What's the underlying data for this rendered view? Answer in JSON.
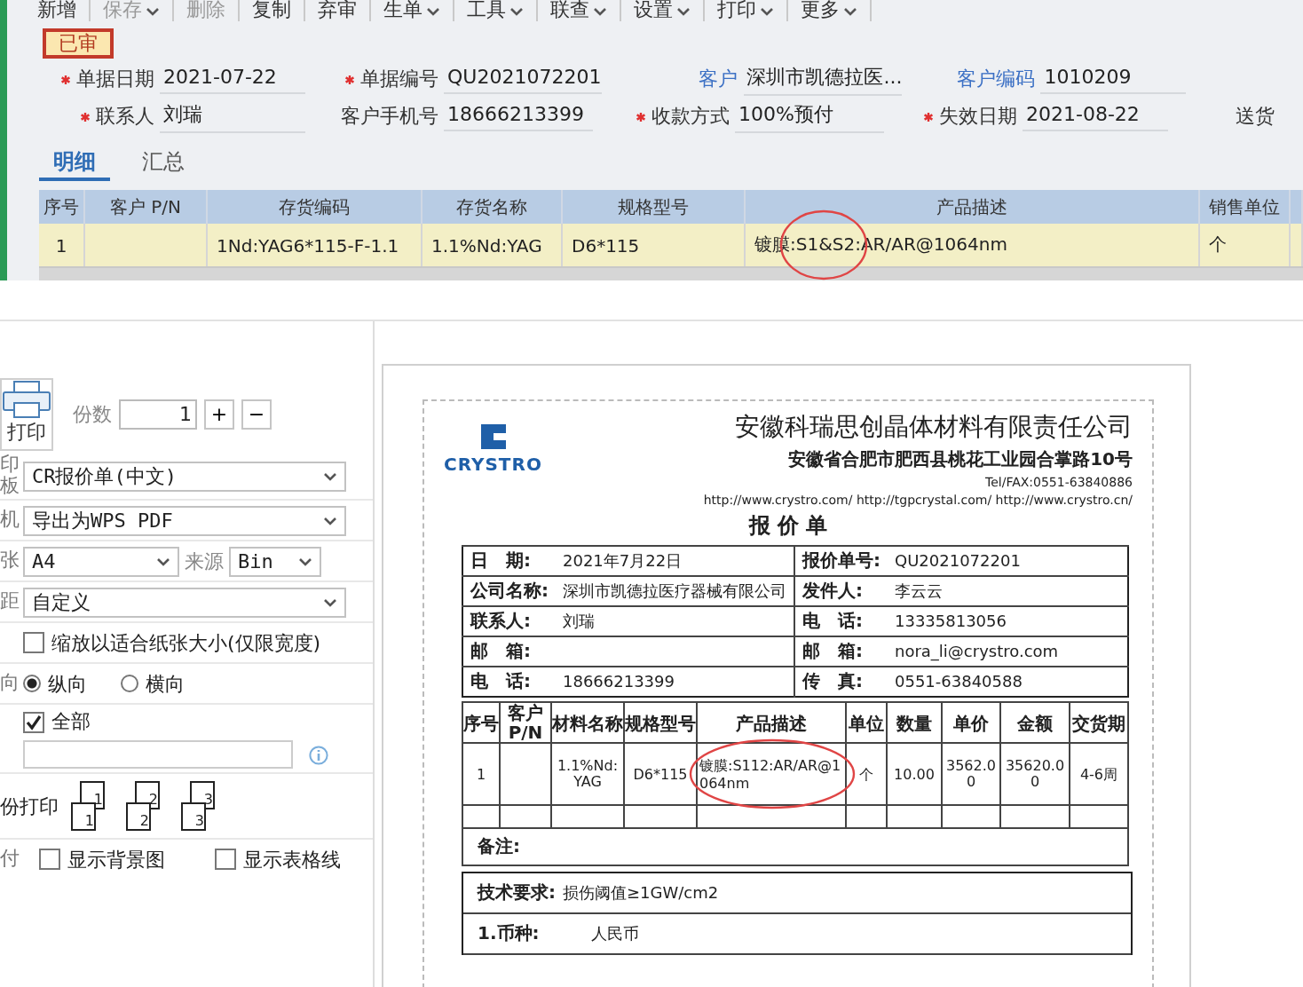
{
  "toolbar": [
    {
      "label": "新增",
      "disabled": false,
      "menu": false
    },
    {
      "label": "保存",
      "disabled": true,
      "menu": true
    },
    {
      "label": "删除",
      "disabled": true,
      "menu": false
    },
    {
      "label": "复制",
      "disabled": false,
      "menu": false
    },
    {
      "label": "弃审",
      "disabled": false,
      "menu": false
    },
    {
      "label": "生单",
      "disabled": false,
      "menu": true
    },
    {
      "label": "工具",
      "disabled": false,
      "menu": true
    },
    {
      "label": "联查",
      "disabled": false,
      "menu": true
    },
    {
      "label": "设置",
      "disabled": false,
      "menu": true
    },
    {
      "label": "打印",
      "disabled": false,
      "menu": true
    },
    {
      "label": "更多",
      "disabled": false,
      "menu": true
    }
  ],
  "status_badge": "已审",
  "form_rows": [
    [
      {
        "label": "单据日期",
        "required": true,
        "kind": "plain",
        "value": "2021-07-22"
      },
      {
        "label": "单据编号",
        "required": true,
        "kind": "plain",
        "value": "QU2021072201"
      },
      {
        "label": "客户",
        "required": false,
        "kind": "link",
        "value": "深圳市凯德拉医..."
      },
      {
        "label": "客户编码",
        "required": false,
        "kind": "link",
        "value": "1010209"
      }
    ],
    [
      {
        "label": "联系人",
        "required": true,
        "kind": "plain",
        "value": "刘瑞"
      },
      {
        "label": "客户手机号",
        "required": false,
        "kind": "plain",
        "value": "18666213399"
      },
      {
        "label": "收款方式",
        "required": true,
        "kind": "plain",
        "value": "100%预付"
      },
      {
        "label": "失效日期",
        "required": true,
        "kind": "plain",
        "value": "2021-08-22"
      },
      {
        "label": "送货",
        "required": false,
        "kind": "plain"
      }
    ]
  ],
  "tabs": [
    {
      "label": "明细",
      "selected": true
    },
    {
      "label": "汇总",
      "selected": false
    }
  ],
  "grid": {
    "columns": [
      "序号",
      "客户 P/N",
      "存货编码",
      "存货名称",
      "规格型号",
      "产品描述",
      "销售单位"
    ],
    "rows": [
      {
        "selected": true,
        "cells": [
          "1",
          null,
          "1Nd:YAG6*115-F-1.1",
          "1.1%Nd:YAG",
          "D6*115",
          "镀膜:S1&S2:AR/AR@1064nm",
          "个"
        ]
      }
    ]
  },
  "print_panel": {
    "print_button": "打印",
    "copies_label": "份数",
    "copies": "1",
    "plus": "+",
    "minus": "−",
    "template": {
      "label": "印板",
      "value": "CR报价单(中文)"
    },
    "printer": {
      "label": "机",
      "value": "导出为WPS PDF"
    },
    "paper": {
      "label": "张",
      "value": "A4",
      "source_label": "来源",
      "source": "Bin"
    },
    "margin": {
      "label": "距",
      "value": "自定义"
    },
    "fit_width": {
      "label": "缩放以适合纸张大小(仅限宽度)",
      "checked": false
    },
    "orientation": {
      "label": "向",
      "options": [
        {
          "label": "纵向",
          "selected": true
        },
        {
          "label": "横向",
          "selected": false
        }
      ]
    },
    "range": {
      "label": "全部",
      "checked": true
    },
    "collate": {
      "label": "份打印",
      "icons": [
        {
          "back": "1",
          "front": "1"
        },
        {
          "back": "2",
          "front": "2"
        },
        {
          "back": "3",
          "front": "3"
        }
      ]
    },
    "show": {
      "label": "付",
      "options": [
        {
          "label": "显示背景图",
          "checked": false
        },
        {
          "label": "显示表格线",
          "checked": false
        }
      ]
    }
  },
  "preview": {
    "logo_text": "CRYSTRO",
    "company": "安徽科瑞思创晶体材料有限责任公司",
    "address": "安徽省合肥市肥西县桃花工业园合掌路10号",
    "tel": "Tel/FAX:0551-63840886",
    "urls": "http://www.crystro.com/ http://tgpcrystal.com/ http://www.crystro.cn/",
    "title": "报 价 单",
    "info": [
      [
        {
          "label": "日　期:",
          "value": "2021年7月22日"
        },
        {
          "label": "报价单号:",
          "value": "QU2021072201"
        }
      ],
      [
        {
          "label": "公司名称:",
          "value": "深圳市凯德拉医疗器械有限公司"
        },
        {
          "label": "发件人:",
          "value": "李云云"
        }
      ],
      [
        {
          "label": "联系人:",
          "value": "刘瑞"
        },
        {
          "label": "电　话:",
          "value": "13335813056"
        }
      ],
      [
        {
          "label": "邮　箱:"
        },
        {
          "label": "邮　箱:",
          "value": "nora_li@crystro.com"
        }
      ],
      [
        {
          "label": "电　话:",
          "value": "18666213399"
        },
        {
          "label": "传　真:",
          "value": "0551-63840588"
        }
      ]
    ],
    "items": {
      "columns": [
        "序号",
        "客户P/N",
        "材料名称",
        "规格型号",
        "产品描述",
        "单位",
        "数量",
        "单价",
        "金额",
        "交货期"
      ],
      "rows": [
        [
          "1",
          null,
          "1.1%Nd:YAG",
          "D6*115",
          "镀膜:S112:AR/AR@1064nm",
          "个",
          "10.00",
          "3562.00",
          "35620.00",
          "4-6周"
        ]
      ]
    },
    "remark_label": "备注:",
    "tech_label": "技术要求:",
    "tech_value": "损伤阈值≥1GW/cm2",
    "currency_label": "1.币种:",
    "currency_value": "人民币"
  }
}
